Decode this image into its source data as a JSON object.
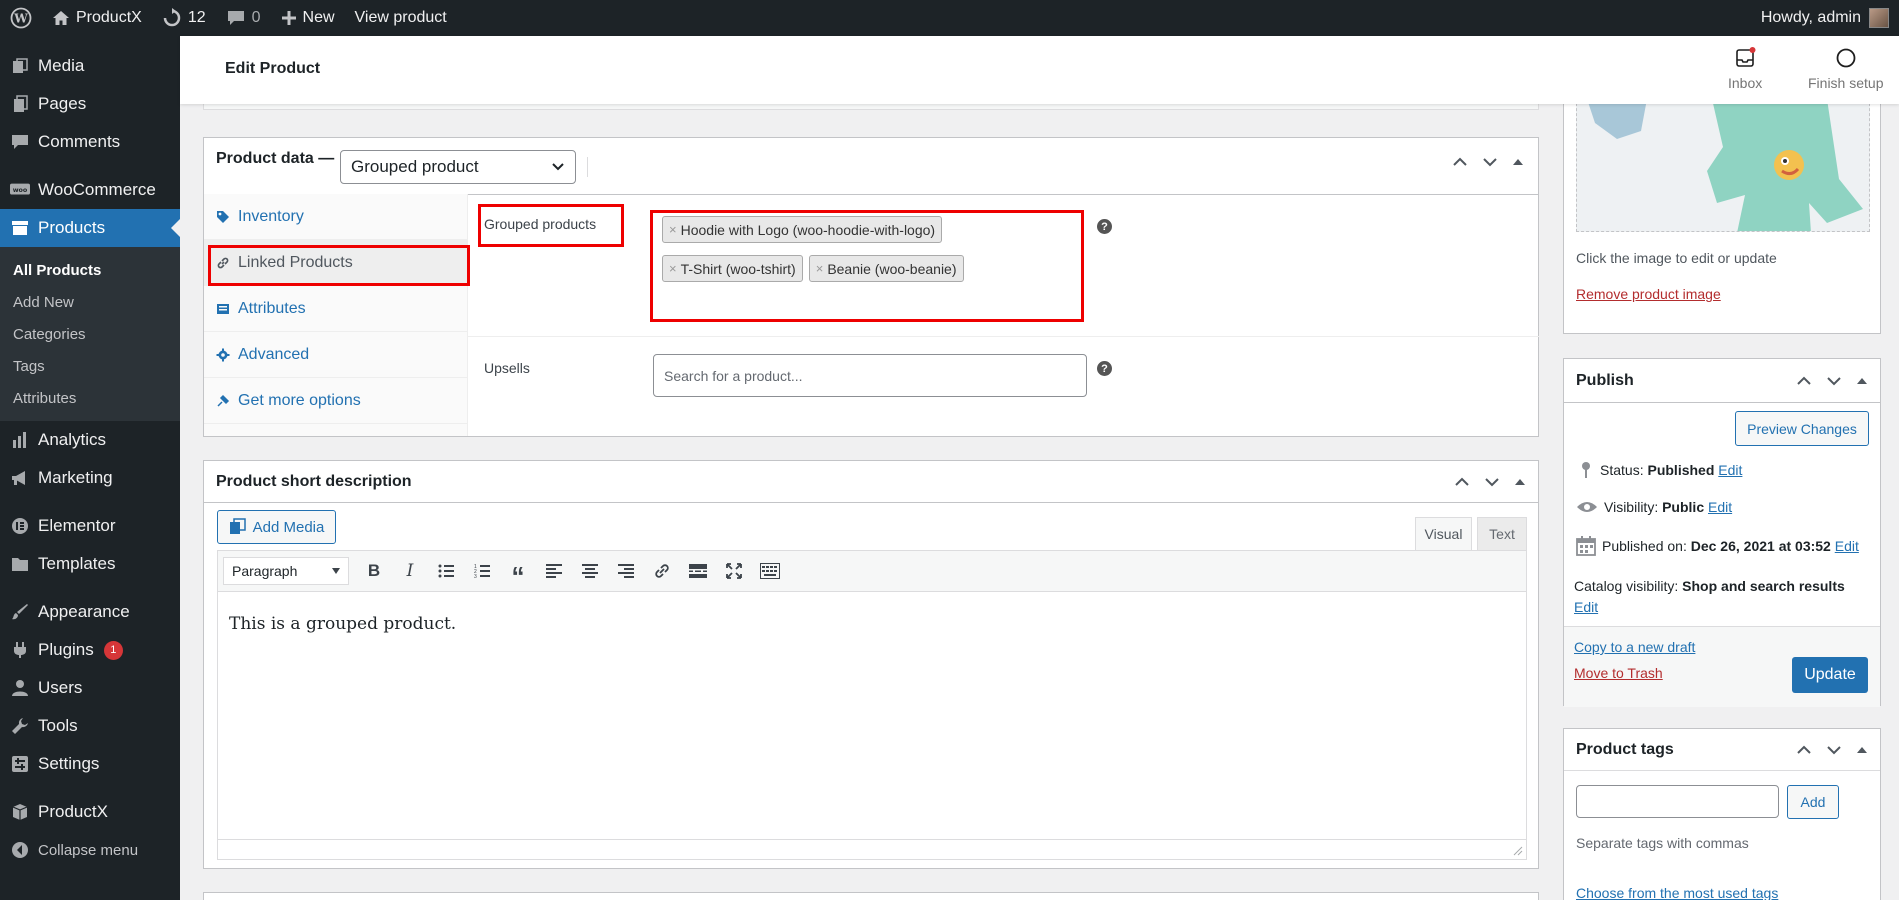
{
  "adminbar": {
    "site_name": "ProductX",
    "updates_count": "12",
    "comments_count": "0",
    "new_label": "New",
    "view_label": "View product",
    "howdy": "Howdy, admin"
  },
  "sidebar": {
    "items_top": [
      {
        "label": "Media",
        "icon": "media-icon"
      },
      {
        "label": "Pages",
        "icon": "pages-icon"
      },
      {
        "label": "Comments",
        "icon": "comments-icon"
      }
    ],
    "woocommerce": "WooCommerce",
    "products": "Products",
    "submenu": [
      "All Products",
      "Add New",
      "Categories",
      "Tags",
      "Attributes"
    ],
    "items_bottom": [
      {
        "label": "Analytics",
        "icon": "analytics-icon"
      },
      {
        "label": "Marketing",
        "icon": "marketing-icon"
      }
    ],
    "elementor": "Elementor",
    "templates": "Templates",
    "appearance": "Appearance",
    "plugins": "Plugins",
    "plugins_badge": "1",
    "users": "Users",
    "tools": "Tools",
    "settings": "Settings",
    "productx": "ProductX",
    "collapse": "Collapse menu"
  },
  "header": {
    "title": "Edit Product",
    "inbox": "Inbox",
    "finish_setup": "Finish setup"
  },
  "product_data": {
    "label": "Product data —",
    "type_selected": "Grouped product",
    "tabs": [
      "Inventory",
      "Linked Products",
      "Attributes",
      "Advanced",
      "Get more options"
    ],
    "grouped_label": "Grouped products",
    "grouped_tokens": [
      "Hoodie with Logo (woo-hoodie-with-logo)",
      "T-Shirt (woo-tshirt)",
      "Beanie (woo-beanie)"
    ],
    "upsells_label": "Upsells",
    "upsells_placeholder": "Search for a product..."
  },
  "short_description": {
    "title": "Product short description",
    "add_media": "Add Media",
    "tab_visual": "Visual",
    "tab_text": "Text",
    "format": "Paragraph",
    "content": "This is a grouped product."
  },
  "product_image": {
    "hint": "Click the image to edit or update",
    "remove": "Remove product image"
  },
  "publish": {
    "title": "Publish",
    "preview": "Preview Changes",
    "status_label": "Status:",
    "status_value": "Published",
    "visibility_label": "Visibility:",
    "visibility_value": "Public",
    "published_label": "Published on:",
    "published_value": "Dec 26, 2021 at 03:52",
    "catalog_label": "Catalog visibility:",
    "catalog_value": "Shop and search results",
    "edit": "Edit",
    "copy_draft": "Copy to a new draft",
    "trash": "Move to Trash",
    "update": "Update"
  },
  "tags": {
    "title": "Product tags",
    "add": "Add",
    "hint": "Separate tags with commas",
    "choose": "Choose from the most used tags"
  },
  "colors": {
    "accent": "#2271b1",
    "highlight": "#e00000",
    "sidebar": "#1d2327"
  }
}
